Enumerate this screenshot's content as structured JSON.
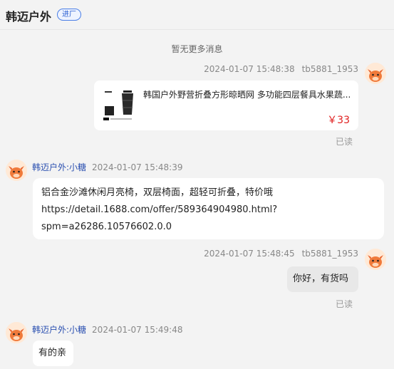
{
  "header": {
    "shop_name": "韩迈户外",
    "badge": "进厂"
  },
  "system_note": "暂无更多消息",
  "messages": [
    {
      "type": "product-card",
      "side": "right",
      "time": "2024-01-07 15:48:38",
      "sender": "tb5881_1953",
      "title": "韩国户外野营折叠方形晾晒网 多功能四层餐具水果蔬...",
      "price": "￥33",
      "status": "已读"
    },
    {
      "type": "text",
      "side": "left",
      "sender": "韩迈户外:小糖",
      "time": "2024-01-07 15:48:39",
      "lines": [
        "铝合金沙滩休闲月亮椅，双层椅面，超轻可折叠，特价哦",
        "https://detail.1688.com/offer/589364904980.html?",
        "spm=a26286.10576602.0.0"
      ]
    },
    {
      "type": "text",
      "side": "right",
      "time": "2024-01-07 15:48:45",
      "sender": "tb5881_1953",
      "text": "你好，有货吗",
      "status": "已读"
    },
    {
      "type": "text",
      "side": "left",
      "sender": "韩迈户外:小糖",
      "time": "2024-01-07 15:49:48",
      "text": "有的亲"
    }
  ]
}
